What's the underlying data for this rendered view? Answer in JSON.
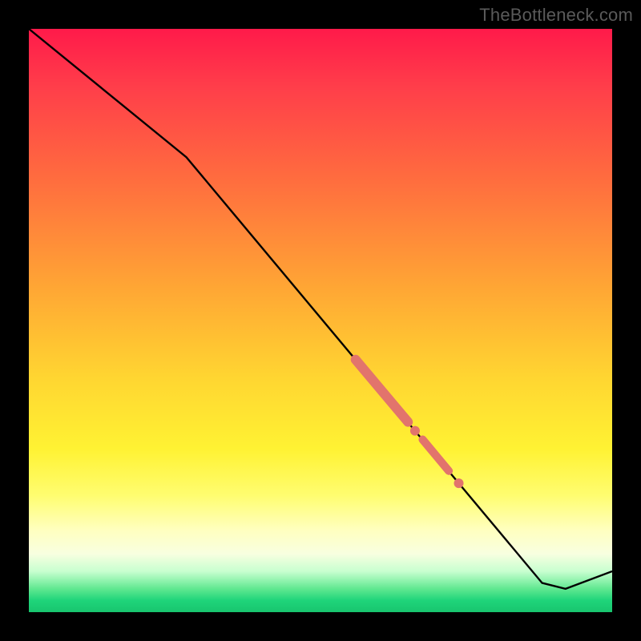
{
  "watermark": "TheBottleneck.com",
  "colors": {
    "line": "#000000",
    "highlight": "#e2746c",
    "gradient_top": "#ff1a4a",
    "gradient_bottom": "#18c56e"
  },
  "chart_data": {
    "type": "line",
    "title": "",
    "xlabel": "",
    "ylabel": "",
    "xlim": [
      0,
      100
    ],
    "ylim": [
      0,
      100
    ],
    "grid": false,
    "legend": false,
    "series": [
      {
        "name": "curve",
        "x": [
          0,
          27,
          88,
          92,
          100
        ],
        "y": [
          100,
          78,
          5,
          4,
          7
        ],
        "comment": "y read as percentage of plot height from bottom"
      }
    ],
    "highlight_segments": [
      {
        "name": "thick-upper",
        "x0": 56,
        "y0": 43.3,
        "x1": 65,
        "y1": 32.6,
        "width": 12
      },
      {
        "name": "thick-lower",
        "x0": 67.5,
        "y0": 29.6,
        "x1": 72,
        "y1": 24.2,
        "width": 10
      }
    ],
    "highlight_dots": [
      {
        "name": "dot-mid",
        "x": 66.2,
        "y": 31.1,
        "r": 6
      },
      {
        "name": "dot-low",
        "x": 73.7,
        "y": 22.1,
        "r": 6
      }
    ]
  }
}
